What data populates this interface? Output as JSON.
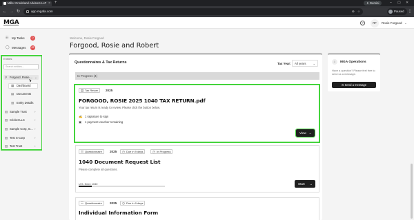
{
  "browser": {
    "tab_title": "Miller Grodeland Advisors LLP",
    "new_tab": "+",
    "gemini": "✦ Gemini",
    "url": "app.mgafa.com",
    "paused": "Paused",
    "win_min": "–",
    "win_max": "▢",
    "win_close": "✕"
  },
  "header": {
    "logo": "MGA",
    "avatar_initials": "RF",
    "user_name": "Rosie Forgood"
  },
  "sidebar": {
    "my_tasks": "My Tasks",
    "my_tasks_count": "0",
    "messages": "Messages",
    "messages_count": "22",
    "entities_label": "Entities",
    "search_placeholder": "Search entities...",
    "entities": [
      {
        "label": "Forgood, Rosie ..."
      },
      {
        "label": "Sample Trust"
      },
      {
        "label": "Cricket LLC"
      },
      {
        "label": "Sample Corp, In..."
      },
      {
        "label": "Test S-Corp"
      },
      {
        "label": "Test Trust"
      }
    ],
    "sub_items": [
      {
        "label": "Dashboard"
      },
      {
        "label": "Documents"
      },
      {
        "label": "Entity Details"
      }
    ]
  },
  "main": {
    "welcome": "Welcome, Rosie Forgood",
    "title": "Forgood, Rosie and Robert",
    "card_title": "Questionnaires & Tax Returns",
    "tax_year_label": "Tax Year:",
    "tax_year_value": "All years",
    "in_progress": "In Progress (4)",
    "items": [
      {
        "chip": "Tax Return",
        "year": "2025",
        "title": "FORGOOD, ROSIE 2025 1040 TAX RETURN.pdf",
        "desc": "Your tax return is ready to review. Please click the button below.",
        "line1": "1 signature to sign",
        "line2": "1 payment voucher remaining",
        "button": "View"
      },
      {
        "chip": "Questionnaire",
        "year": "2025",
        "due": "Due in 9 days",
        "status": "In Progress",
        "title": "1040 Document Request List",
        "desc": "Please complete all questions.",
        "next": "U.S. Next: 1040",
        "progress": 0.15,
        "button": "Start"
      },
      {
        "chip": "Questionnaire",
        "year": "2025",
        "due": "Due in 9 days",
        "title": "Individual Information Form"
      }
    ]
  },
  "ops": {
    "title": "MGA Operations",
    "desc": "Have a question? Please feel free to send us a message.",
    "button": "Send a message"
  },
  "colors": {
    "highlight": "#44d43c",
    "badge": "#e05252",
    "dark_button": "#1f1f1f"
  },
  "icons": [
    "search-icon",
    "star-icon",
    "user-icon",
    "list-icon",
    "chat-icon",
    "building-icon",
    "document-icon",
    "pen-icon",
    "receipt-icon",
    "clock-icon",
    "help-icon",
    "arrow-right-icon",
    "chevron-down-icon",
    "chevron-right-icon"
  ]
}
